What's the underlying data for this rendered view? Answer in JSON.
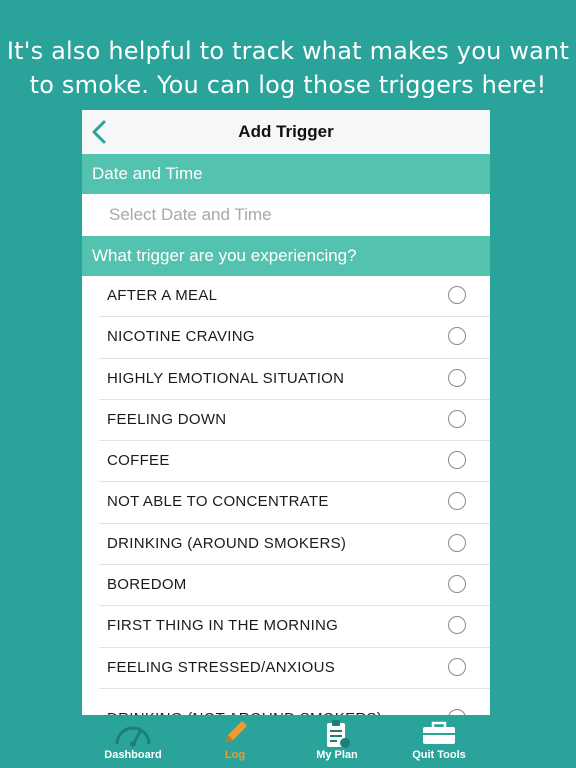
{
  "promo": {
    "line1": "It's also helpful to track what makes you want",
    "line2": "to smoke. You can log those triggers here!"
  },
  "navbar": {
    "back_icon": "chevron-left-icon",
    "title": "Add Trigger"
  },
  "date_section": {
    "header": "Date and Time",
    "placeholder": "Select Date and Time"
  },
  "trigger_section": {
    "header": "What trigger are you experiencing?",
    "items": [
      {
        "label": "AFTER A MEAL",
        "selected": false
      },
      {
        "label": "NICOTINE CRAVING",
        "selected": false
      },
      {
        "label": "HIGHLY EMOTIONAL SITUATION",
        "selected": false
      },
      {
        "label": "FEELING DOWN",
        "selected": false
      },
      {
        "label": "COFFEE",
        "selected": false
      },
      {
        "label": "NOT ABLE TO CONCENTRATE",
        "selected": false
      },
      {
        "label": "DRINKING (AROUND SMOKERS)",
        "selected": false
      },
      {
        "label": "BOREDOM",
        "selected": false
      },
      {
        "label": "FIRST THING IN THE MORNING",
        "selected": false
      },
      {
        "label": "FEELING STRESSED/ANXIOUS",
        "selected": false
      },
      {
        "label": "DRINKING (NOT AROUND SMOKERS)",
        "selected": false
      }
    ]
  },
  "tabbar": {
    "tabs": [
      {
        "label": "Dashboard",
        "icon": "gauge-icon",
        "active": false
      },
      {
        "label": "Log",
        "icon": "pencil-icon",
        "active": true
      },
      {
        "label": "My Plan",
        "icon": "clipboard-icon",
        "active": false
      },
      {
        "label": "Quit Tools",
        "icon": "toolbox-icon",
        "active": false
      }
    ]
  },
  "colors": {
    "background": "#2aa39b",
    "section_header": "#53c2ae",
    "active_tab": "#f29a2e"
  }
}
